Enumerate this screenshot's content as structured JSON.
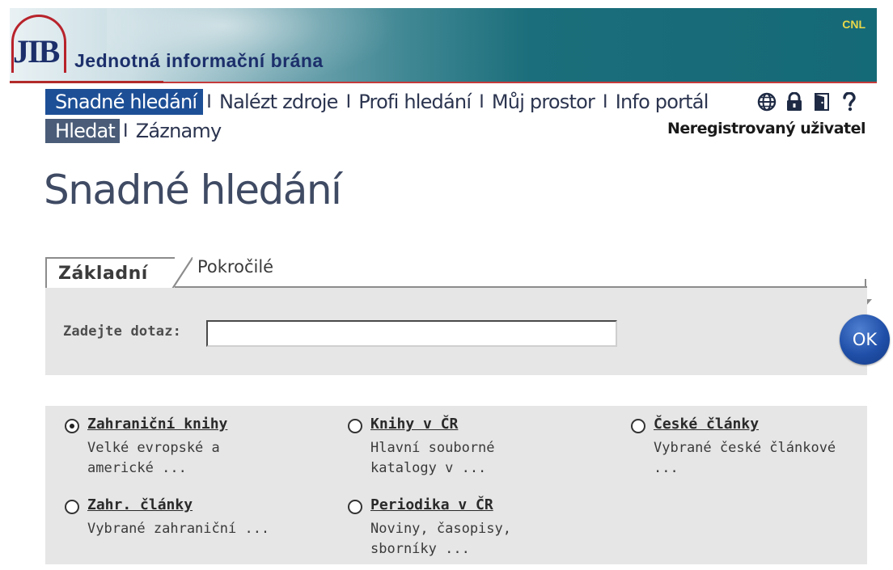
{
  "header": {
    "logo_text": "JIB",
    "site_name": "Jednotná informační brána",
    "org": "CNL"
  },
  "topnav": {
    "items": [
      {
        "label": "Snadné hledání",
        "active": true
      },
      {
        "label": "Nalézt zdroje",
        "active": false
      },
      {
        "label": "Profi hledání",
        "active": false
      },
      {
        "label": "Můj prostor",
        "active": false
      },
      {
        "label": "Info portál",
        "active": false
      }
    ],
    "separator": "I",
    "icons": [
      "globe-icon",
      "lock-icon",
      "exit-door-icon",
      "help-icon"
    ]
  },
  "subnav": {
    "items": [
      {
        "label": "Hledat",
        "active": true
      },
      {
        "label": "Záznamy",
        "active": false
      }
    ],
    "user_status": "Neregistrovaný uživatel"
  },
  "page": {
    "title": "Snadné hledání"
  },
  "tabs": {
    "basic": "Základní",
    "advanced": "Pokročilé"
  },
  "query": {
    "label": "Zadejte dotaz:",
    "value": "",
    "ok_label": "OK"
  },
  "sources": [
    {
      "title": "Zahraniční knihy",
      "desc": "Velké evropské a americké ...",
      "checked": true
    },
    {
      "title": "Knihy v ČR",
      "desc": "Hlavní souborné katalogy v ...",
      "checked": false
    },
    {
      "title": "České články",
      "desc": "Vybrané české článkové ...",
      "checked": false
    },
    {
      "title": "Zahr. články",
      "desc": "Vybrané zahraniční ...",
      "checked": false
    },
    {
      "title": "Periodika v ČR",
      "desc": "Noviny, časopisy, sborníky ...",
      "checked": false
    }
  ],
  "colors": {
    "nav_active": "#1d4f96",
    "subnav_active": "#4a5c78",
    "ok_button": "#1f4fa8",
    "panel_bg": "#e6e6e6"
  }
}
